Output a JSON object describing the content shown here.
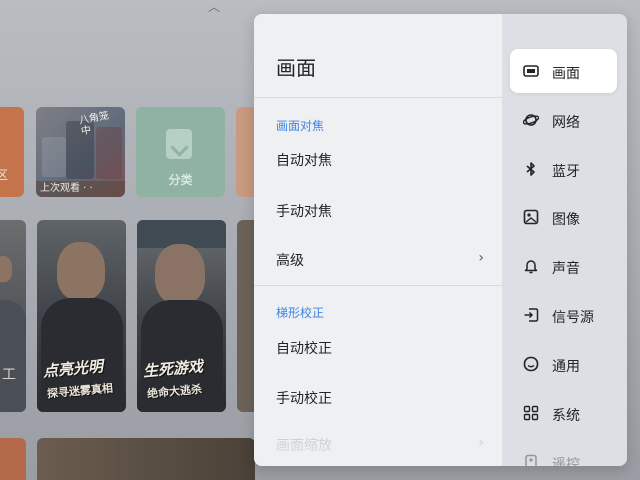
{
  "background": {
    "tiles": {
      "orange_label": "区",
      "recent_title": "八角笼中",
      "recent_label": "上次观看 · ·",
      "category_label": "分类"
    },
    "posters": [
      {
        "title": "工",
        "subtitle": ""
      },
      {
        "title": "点亮光明",
        "subtitle": "探寻迷雾真相"
      },
      {
        "title": "生死游戏",
        "subtitle": "绝命大逃杀"
      }
    ]
  },
  "panel": {
    "title": "画面",
    "sections": [
      {
        "header": "画面对焦",
        "items": [
          {
            "label": "自动对焦",
            "has_arrow": false
          },
          {
            "label": "手动对焦",
            "has_arrow": false
          },
          {
            "label": "高级",
            "has_arrow": true
          }
        ]
      },
      {
        "header": "梯形校正",
        "items": [
          {
            "label": "自动校正",
            "has_arrow": false
          },
          {
            "label": "手动校正",
            "has_arrow": false
          },
          {
            "label": "画面缩放",
            "has_arrow": true
          }
        ]
      }
    ],
    "arrow_glyph": "›"
  },
  "nav": {
    "active_index": 0,
    "items": [
      {
        "label": "画面",
        "icon": "picture-mode-icon"
      },
      {
        "label": "网络",
        "icon": "planet-network-icon"
      },
      {
        "label": "蓝牙",
        "icon": "bluetooth-icon"
      },
      {
        "label": "图像",
        "icon": "image-icon"
      },
      {
        "label": "声音",
        "icon": "bell-sound-icon"
      },
      {
        "label": "信号源",
        "icon": "signal-source-icon"
      },
      {
        "label": "通用",
        "icon": "general-smiley-icon"
      },
      {
        "label": "系统",
        "icon": "system-grid-icon"
      },
      {
        "label": "遥控",
        "icon": "remote-icon"
      }
    ]
  },
  "colors": {
    "accent": "#3f84e5",
    "text": "#222427",
    "panel": "#eef0f2",
    "nav": "#dcdfe3"
  }
}
